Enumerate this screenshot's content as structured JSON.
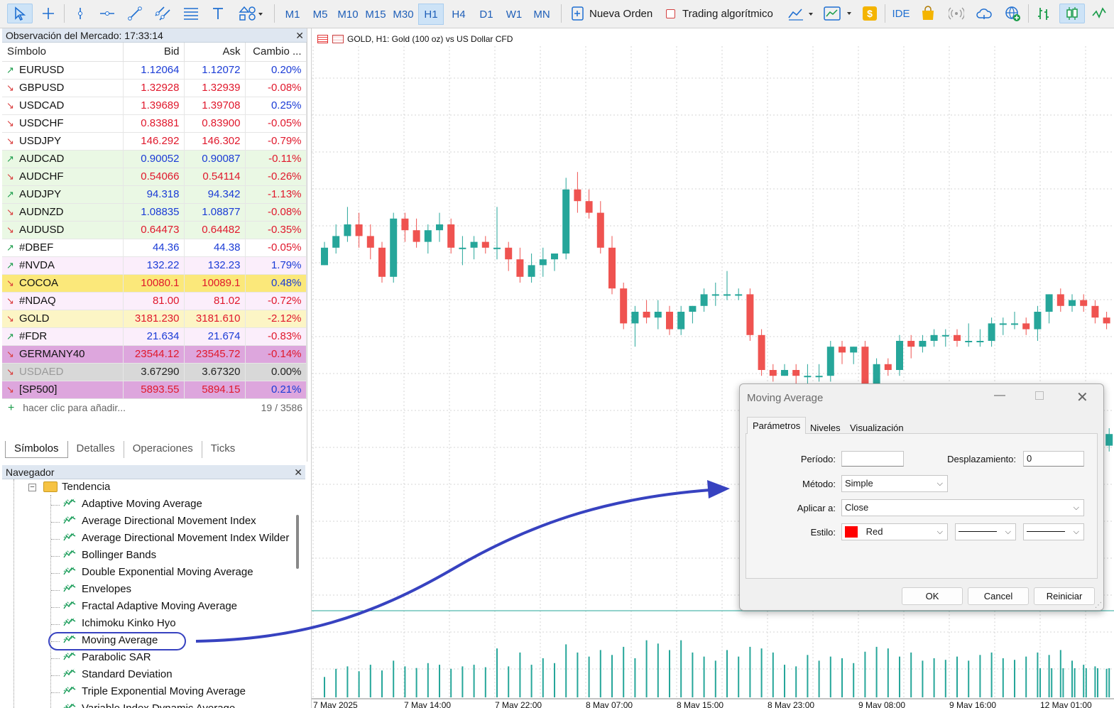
{
  "toolbar": {
    "timeframes": [
      "M1",
      "M5",
      "M10",
      "M15",
      "M30",
      "H1",
      "H4",
      "D1",
      "W1",
      "MN"
    ],
    "active_timeframe": "H1",
    "new_order_label": "Nueva Orden",
    "algo_trading_label": "Trading algorítmico",
    "ide_label": "IDE"
  },
  "market_watch": {
    "title": "Observación del Mercado: 17:33:14",
    "close": "✕",
    "columns": [
      "Símbolo",
      "Bid",
      "Ask",
      "Cambio ..."
    ],
    "rows": [
      {
        "symbol": "EURUSD",
        "bid": "1.12064",
        "ask": "1.12072",
        "change": "0.20%",
        "dir": "up",
        "bg": "#ffffff",
        "bidc": "blue",
        "chc": "blue"
      },
      {
        "symbol": "GBPUSD",
        "bid": "1.32928",
        "ask": "1.32939",
        "change": "-0.08%",
        "dir": "dn",
        "bg": "#ffffff",
        "bidc": "red",
        "chc": "red"
      },
      {
        "symbol": "USDCAD",
        "bid": "1.39689",
        "ask": "1.39708",
        "change": "0.25%",
        "dir": "dn",
        "bg": "#ffffff",
        "bidc": "red",
        "chc": "blue"
      },
      {
        "symbol": "USDCHF",
        "bid": "0.83881",
        "ask": "0.83900",
        "change": "-0.05%",
        "dir": "dn",
        "bg": "#ffffff",
        "bidc": "red",
        "chc": "red"
      },
      {
        "symbol": "USDJPY",
        "bid": "146.292",
        "ask": "146.302",
        "change": "-0.79%",
        "dir": "dn",
        "bg": "#ffffff",
        "bidc": "red",
        "chc": "red"
      },
      {
        "symbol": "AUDCAD",
        "bid": "0.90052",
        "ask": "0.90087",
        "change": "-0.11%",
        "dir": "up",
        "bg": "#eaf8e4",
        "bidc": "blue",
        "chc": "red"
      },
      {
        "symbol": "AUDCHF",
        "bid": "0.54066",
        "ask": "0.54114",
        "change": "-0.26%",
        "dir": "dn",
        "bg": "#eaf8e4",
        "bidc": "red",
        "chc": "red"
      },
      {
        "symbol": "AUDJPY",
        "bid": "94.318",
        "ask": "94.342",
        "change": "-1.13%",
        "dir": "up",
        "bg": "#eaf8e4",
        "bidc": "blue",
        "chc": "red"
      },
      {
        "symbol": "AUDNZD",
        "bid": "1.08835",
        "ask": "1.08877",
        "change": "-0.08%",
        "dir": "dn",
        "bg": "#eaf8e4",
        "bidc": "blue",
        "chc": "red"
      },
      {
        "symbol": "AUDUSD",
        "bid": "0.64473",
        "ask": "0.64482",
        "change": "-0.35%",
        "dir": "dn",
        "bg": "#eaf8e4",
        "bidc": "red",
        "chc": "red"
      },
      {
        "symbol": "#DBEF",
        "bid": "44.36",
        "ask": "44.38",
        "change": "-0.05%",
        "dir": "up",
        "bg": "#ffffff",
        "bidc": "blue",
        "chc": "red"
      },
      {
        "symbol": "#NVDA",
        "bid": "132.22",
        "ask": "132.23",
        "change": "1.79%",
        "dir": "up",
        "bg": "#fbeefb",
        "bidc": "blue",
        "chc": "blue"
      },
      {
        "symbol": "COCOA",
        "bid": "10080.1",
        "ask": "10089.1",
        "change": "0.48%",
        "dir": "dn",
        "bg": "#fbe87a",
        "bidc": "red",
        "chc": "blue"
      },
      {
        "symbol": "#NDAQ",
        "bid": "81.00",
        "ask": "81.02",
        "change": "-0.72%",
        "dir": "dn",
        "bg": "#fbeefb",
        "bidc": "red",
        "chc": "red"
      },
      {
        "symbol": "GOLD",
        "bid": "3181.230",
        "ask": "3181.610",
        "change": "-2.12%",
        "dir": "dn",
        "bg": "#fcf5c5",
        "bidc": "red",
        "chc": "red"
      },
      {
        "symbol": "#FDR",
        "bid": "21.634",
        "ask": "21.674",
        "change": "-0.83%",
        "dir": "up",
        "bg": "#fbeefb",
        "bidc": "blue",
        "chc": "red"
      },
      {
        "symbol": "GERMANY40",
        "bid": "23544.12",
        "ask": "23545.72",
        "change": "-0.14%",
        "dir": "dn",
        "bg": "#dda6dd",
        "bidc": "red",
        "chc": "red"
      },
      {
        "symbol": "USDAED",
        "bid": "3.67290",
        "ask": "3.67320",
        "change": "0.00%",
        "dir": "dn",
        "bg": "#d8d8d8",
        "bidc": "dark",
        "chc": "dark",
        "symc": "grey"
      },
      {
        "symbol": "[SP500]",
        "bid": "5893.55",
        "ask": "5894.15",
        "change": "0.21%",
        "dir": "dn",
        "bg": "#dda6dd",
        "bidc": "red",
        "chc": "blue"
      }
    ],
    "add_text": "hacer clic para añadir...",
    "count": "19 / 3586",
    "tabs": [
      "Símbolos",
      "Detalles",
      "Operaciones",
      "Ticks"
    ]
  },
  "navigator": {
    "title": "Navegador",
    "close": "✕",
    "folder": "Tendencia",
    "items": [
      "Adaptive Moving Average",
      "Average Directional Movement Index",
      "Average Directional Movement Index Wilder",
      "Bollinger Bands",
      "Double Exponential Moving Average",
      "Envelopes",
      "Fractal Adaptive Moving Average",
      "Ichimoku Kinko Hyo",
      "Moving Average",
      "Parabolic SAR",
      "Standard Deviation",
      "Triple Exponential Moving Average",
      "Variable Index Dynamic Average"
    ]
  },
  "chart": {
    "title": "GOLD, H1:  Gold (100 oz) vs US Dollar CFD",
    "time_labels": [
      "7 May 2025",
      "7 May 14:00",
      "7 May 22:00",
      "8 May 07:00",
      "8 May 15:00",
      "8 May 23:00",
      "9 May 08:00",
      "9 May 16:00",
      "12 May 01:00"
    ],
    "candles": [
      [
        0.63,
        0.67,
        0.63,
        0.66
      ],
      [
        0.66,
        0.7,
        0.65,
        0.68
      ],
      [
        0.68,
        0.73,
        0.67,
        0.7
      ],
      [
        0.7,
        0.72,
        0.66,
        0.68
      ],
      [
        0.68,
        0.7,
        0.64,
        0.66
      ],
      [
        0.66,
        0.67,
        0.6,
        0.61
      ],
      [
        0.61,
        0.72,
        0.6,
        0.71
      ],
      [
        0.71,
        0.72,
        0.67,
        0.69
      ],
      [
        0.69,
        0.71,
        0.66,
        0.67
      ],
      [
        0.67,
        0.7,
        0.65,
        0.69
      ],
      [
        0.69,
        0.72,
        0.67,
        0.7
      ],
      [
        0.7,
        0.71,
        0.65,
        0.66
      ],
      [
        0.66,
        0.68,
        0.63,
        0.66
      ],
      [
        0.66,
        0.68,
        0.64,
        0.67
      ],
      [
        0.67,
        0.68,
        0.65,
        0.66
      ],
      [
        0.66,
        0.73,
        0.64,
        0.66
      ],
      [
        0.66,
        0.67,
        0.62,
        0.64
      ],
      [
        0.64,
        0.66,
        0.6,
        0.61
      ],
      [
        0.61,
        0.65,
        0.6,
        0.63
      ],
      [
        0.63,
        0.66,
        0.61,
        0.64
      ],
      [
        0.64,
        0.65,
        0.62,
        0.65
      ],
      [
        0.65,
        0.78,
        0.64,
        0.76
      ],
      [
        0.76,
        0.79,
        0.72,
        0.74
      ],
      [
        0.74,
        0.76,
        0.71,
        0.72
      ],
      [
        0.72,
        0.74,
        0.65,
        0.66
      ],
      [
        0.66,
        0.68,
        0.58,
        0.59
      ],
      [
        0.59,
        0.6,
        0.52,
        0.53
      ],
      [
        0.53,
        0.56,
        0.49,
        0.55
      ],
      [
        0.55,
        0.57,
        0.53,
        0.54
      ],
      [
        0.54,
        0.57,
        0.52,
        0.55
      ],
      [
        0.55,
        0.56,
        0.51,
        0.52
      ],
      [
        0.52,
        0.56,
        0.51,
        0.55
      ],
      [
        0.55,
        0.56,
        0.53,
        0.56
      ],
      [
        0.56,
        0.59,
        0.55,
        0.58
      ],
      [
        0.58,
        0.6,
        0.56,
        0.58
      ],
      [
        0.58,
        0.62,
        0.57,
        0.58
      ],
      [
        0.58,
        0.59,
        0.57,
        0.58
      ],
      [
        0.58,
        0.59,
        0.5,
        0.51
      ],
      [
        0.51,
        0.52,
        0.44,
        0.45
      ],
      [
        0.45,
        0.46,
        0.43,
        0.44
      ],
      [
        0.44,
        0.46,
        0.44,
        0.45
      ],
      [
        0.45,
        0.46,
        0.4,
        0.44
      ],
      [
        0.44,
        0.46,
        0.42,
        0.44
      ],
      [
        0.44,
        0.46,
        0.43,
        0.44
      ],
      [
        0.44,
        0.5,
        0.43,
        0.49
      ],
      [
        0.49,
        0.5,
        0.46,
        0.48
      ],
      [
        0.48,
        0.49,
        0.46,
        0.49
      ],
      [
        0.49,
        0.5,
        0.4,
        0.41
      ],
      [
        0.41,
        0.47,
        0.38,
        0.46
      ],
      [
        0.46,
        0.47,
        0.44,
        0.45
      ],
      [
        0.45,
        0.51,
        0.44,
        0.5
      ],
      [
        0.5,
        0.51,
        0.47,
        0.49
      ],
      [
        0.49,
        0.51,
        0.48,
        0.5
      ],
      [
        0.5,
        0.52,
        0.49,
        0.51
      ],
      [
        0.51,
        0.52,
        0.49,
        0.51
      ],
      [
        0.51,
        0.52,
        0.49,
        0.5
      ],
      [
        0.5,
        0.53,
        0.49,
        0.5
      ],
      [
        0.5,
        0.52,
        0.49,
        0.5
      ],
      [
        0.5,
        0.54,
        0.49,
        0.53
      ],
      [
        0.53,
        0.54,
        0.51,
        0.53
      ],
      [
        0.53,
        0.55,
        0.52,
        0.53
      ],
      [
        0.53,
        0.54,
        0.51,
        0.52
      ],
      [
        0.52,
        0.56,
        0.5,
        0.55
      ],
      [
        0.55,
        0.58,
        0.53,
        0.58
      ],
      [
        0.58,
        0.59,
        0.55,
        0.56
      ],
      [
        0.56,
        0.58,
        0.55,
        0.57
      ],
      [
        0.57,
        0.58,
        0.55,
        0.56
      ],
      [
        0.56,
        0.57,
        0.53,
        0.54
      ],
      [
        0.54,
        0.55,
        0.52,
        0.53
      ]
    ],
    "volumes": [
      0.25,
      0.35,
      0.38,
      0.32,
      0.4,
      0.33,
      0.45,
      0.38,
      0.36,
      0.42,
      0.4,
      0.35,
      0.38,
      0.4,
      0.37,
      0.6,
      0.38,
      0.55,
      0.4,
      0.48,
      0.42,
      0.65,
      0.55,
      0.5,
      0.58,
      0.52,
      0.62,
      0.48,
      0.7,
      0.66,
      0.58,
      0.7,
      0.55,
      0.5,
      0.45,
      0.58,
      0.5,
      0.62,
      0.6,
      0.55,
      0.4,
      0.38,
      0.52,
      0.45,
      0.5,
      0.48,
      0.42,
      0.56,
      0.62,
      0.6,
      0.5,
      0.55,
      0.45,
      0.48,
      0.46,
      0.5,
      0.45,
      0.52,
      0.55,
      0.48,
      0.46,
      0.5,
      0.55,
      0.52,
      0.58,
      0.45,
      0.4,
      0.38,
      0.35
    ],
    "right_candles": [
      [
        0.35,
        0.4,
        0.3,
        0.31
      ],
      [
        0.31,
        0.38,
        0.3,
        0.37
      ],
      [
        0.37,
        0.38,
        0.32,
        0.34
      ],
      [
        0.34,
        0.35,
        0.3,
        0.31
      ],
      [
        0.31,
        0.35,
        0.29,
        0.34
      ],
      [
        0.34,
        0.35,
        0.3,
        0.32
      ],
      [
        0.32,
        0.35,
        0.31,
        0.34
      ]
    ],
    "colors": {
      "up": "#26a69a",
      "down": "#ef5350"
    }
  },
  "dialog": {
    "title": "Moving Average",
    "tabs": [
      "Parámetros",
      "Niveles",
      "Visualización"
    ],
    "period_label": "Período:",
    "period_value": "",
    "shift_label": "Desplazamiento:",
    "shift_value": "0",
    "method_label": "Método:",
    "method_value": "Simple",
    "apply_label": "Aplicar a:",
    "apply_value": "Close",
    "style_label": "Estilo:",
    "style_color": "Red",
    "ok": "OK",
    "cancel": "Cancel",
    "reset": "Reiniciar"
  }
}
